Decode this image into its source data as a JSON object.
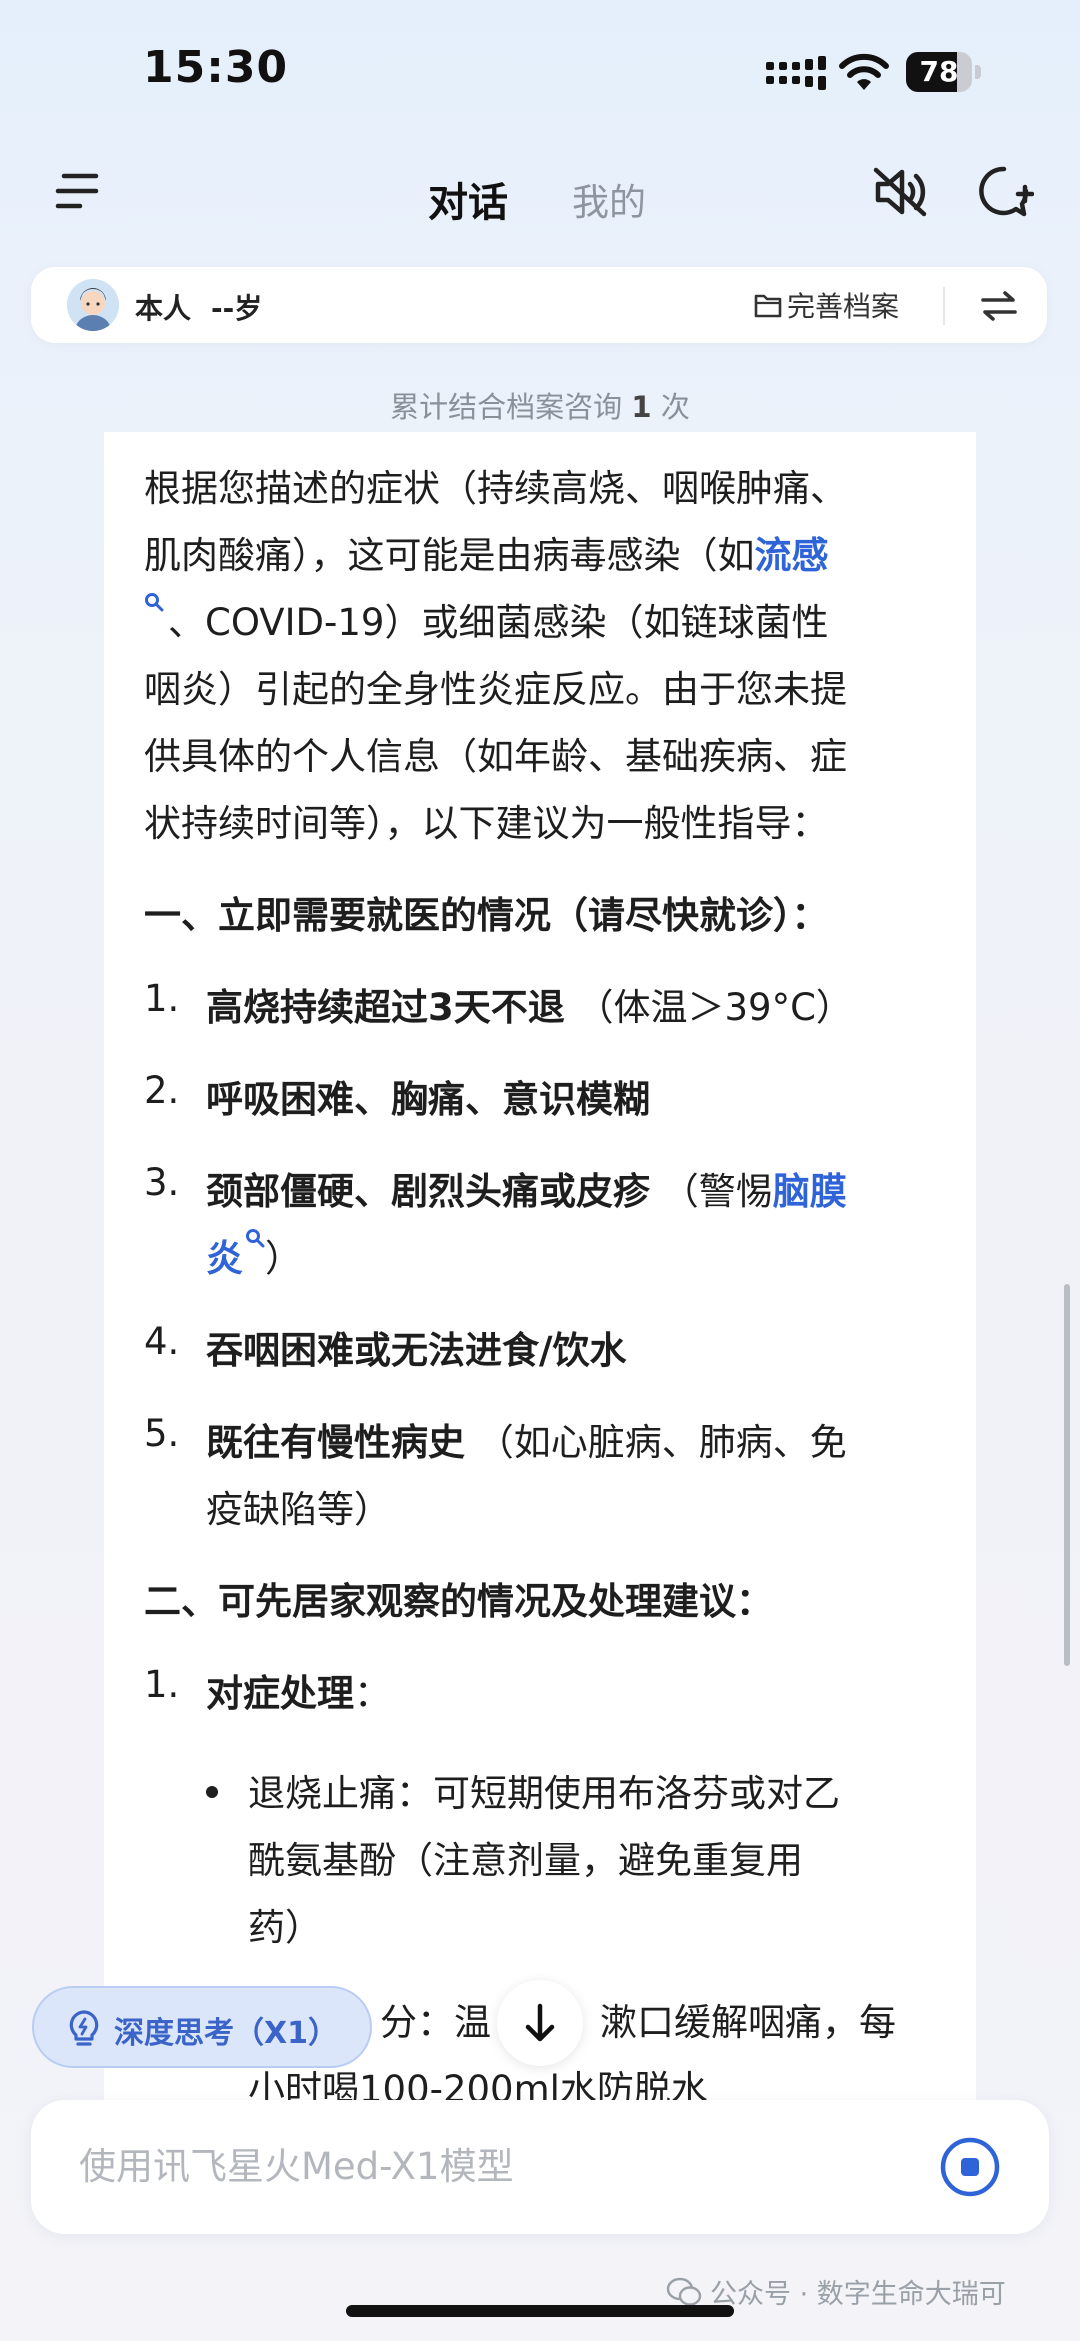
{
  "status_bar": {
    "time": "15:30",
    "battery": "78",
    "battery_level": 0.78
  },
  "nav": {
    "tab_chat": "对话",
    "tab_mine": "我的"
  },
  "profile": {
    "name": "本人",
    "age": "--岁",
    "complete_label": "完善档案"
  },
  "consult": {
    "prefix": "累计结合档案咨询",
    "count": "1",
    "suffix": "次"
  },
  "message": {
    "intro": [
      "根据您描述的症状（持续高烧、咽喉肿痛、",
      "肌肉酸痛），这可能是由病毒感染（如",
      "、COVID-19）或细菌感染（如链球菌性",
      "咽炎）引起的全身性炎症反应。由于您未提",
      "供具体的个人信息（如年龄、基础疾病、症",
      "状持续时间等），以下建议为一般性指导："
    ],
    "link_flu": "流感",
    "section1": "一、立即需要就医的情况（请尽快就诊）：",
    "urgent": [
      {
        "num": "1.",
        "bold": "高烧持续超过3天不退",
        "rest": "（体温＞39°C）"
      },
      {
        "num": "2.",
        "bold": "呼吸困难、胸痛、意识模糊",
        "rest": ""
      },
      {
        "num": "3.",
        "bold": "颈部僵硬、剧烈头痛或皮疹",
        "rest": "（警惕"
      },
      {
        "num": "4.",
        "bold": "吞咽困难或无法进食/饮水",
        "rest": ""
      },
      {
        "num": "5.",
        "bold": "既往有慢性病史",
        "rest": "（如心脏病、肺病、免"
      }
    ],
    "link_meningitis_1": "脑膜",
    "link_meningitis_2": "炎",
    "item3_close": "）",
    "item5_cont": "疫缺陷等）",
    "section2": "二、可先居家观察的情况及处理建议：",
    "care_num": "1.",
    "care_title": "对症处理",
    "care_colon": "：",
    "bullet1": [
      "退烧止痛：可短期使用布洛芬或对乙",
      "酰氨基酚（注意剂量，避免重复用",
      "药）"
    ],
    "bullet2_a": "分：温",
    "bullet2_b": "漱口缓解咽痛，每",
    "bullet2_line2": "小时喝100-200ml水防脱水"
  },
  "deep_think": {
    "label": "深度思考（X1）"
  },
  "input": {
    "placeholder": "使用讯飞星火Med-X1模型"
  },
  "watermark": {
    "text": "公众号 · 数字生命大瑞可"
  },
  "colors": {
    "accent": "#2f63d8",
    "deep_think_bg": "#dbe6fb",
    "text": "#1e1e1e",
    "muted": "#8f959e"
  }
}
